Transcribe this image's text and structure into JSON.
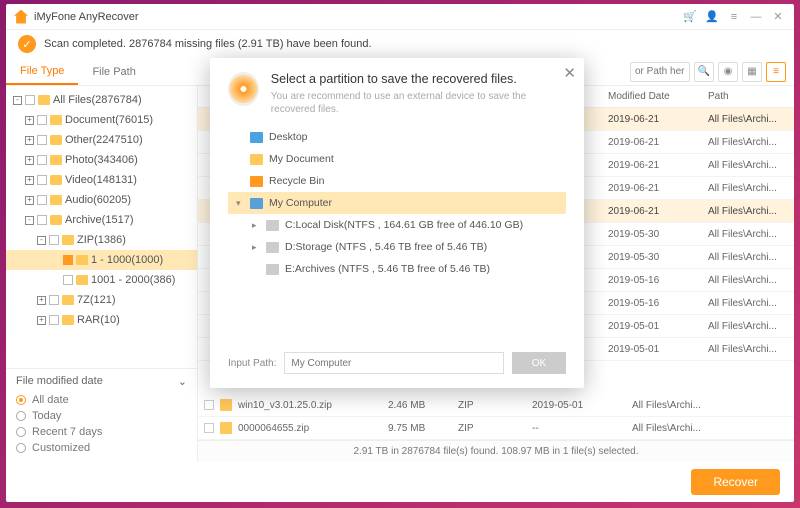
{
  "app_title": "iMyFone AnyRecover",
  "status": "Scan completed. 2876784 missing files (2.91 TB) have been found.",
  "tabs": {
    "file_type": "File Type",
    "file_path": "File Path"
  },
  "search_placeholder": "or Path here",
  "tree": [
    {
      "indent": 0,
      "label": "All Files(2876784)",
      "tog": "-"
    },
    {
      "indent": 1,
      "label": "Document(76015)",
      "tog": "+"
    },
    {
      "indent": 1,
      "label": "Other(2247510)",
      "tog": "+"
    },
    {
      "indent": 1,
      "label": "Photo(343406)",
      "tog": "+"
    },
    {
      "indent": 1,
      "label": "Video(148131)",
      "tog": "+"
    },
    {
      "indent": 1,
      "label": "Audio(60205)",
      "tog": "+"
    },
    {
      "indent": 1,
      "label": "Archive(1517)",
      "tog": "-"
    },
    {
      "indent": 2,
      "label": "ZIP(1386)",
      "tog": "-"
    },
    {
      "indent": 3,
      "label": "1 - 1000(1000)",
      "tog": "",
      "sel": true
    },
    {
      "indent": 3,
      "label": "1001 - 2000(386)",
      "tog": ""
    },
    {
      "indent": 2,
      "label": "7Z(121)",
      "tog": "+"
    },
    {
      "indent": 2,
      "label": "RAR(10)",
      "tog": "+"
    }
  ],
  "modified_section": {
    "title": "File modified date",
    "options": [
      "All date",
      "Today",
      "Recent 7 days",
      "Customized"
    ]
  },
  "columns": {
    "mod": "Modified Date",
    "path": "Path"
  },
  "rows": [
    {
      "mod": "2019-06-21",
      "path": "All Files\\Archi...",
      "sel": true
    },
    {
      "mod": "2019-06-21",
      "path": "All Files\\Archi..."
    },
    {
      "mod": "2019-06-21",
      "path": "All Files\\Archi..."
    },
    {
      "mod": "2019-06-21",
      "path": "All Files\\Archi..."
    },
    {
      "mod": "2019-06-21",
      "path": "All Files\\Archi...",
      "sel": true
    },
    {
      "mod": "2019-05-30",
      "path": "All Files\\Archi..."
    },
    {
      "mod": "2019-05-30",
      "path": "All Files\\Archi..."
    },
    {
      "mod": "2019-05-16",
      "path": "All Files\\Archi..."
    },
    {
      "mod": "2019-05-16",
      "path": "All Files\\Archi..."
    },
    {
      "mod": "2019-05-01",
      "path": "All Files\\Archi..."
    },
    {
      "mod": "2019-05-01",
      "path": "All Files\\Archi..."
    }
  ],
  "full_rows": [
    {
      "name": "win10_v3.01.25.0.zip",
      "size": "2.46 MB",
      "type": "ZIP",
      "mod": "2019-05-01",
      "path": "All Files\\Archi..."
    },
    {
      "name": "0000064655.zip",
      "size": "9.75 MB",
      "type": "ZIP",
      "mod": "--",
      "path": "All Files\\Archi..."
    }
  ],
  "summary": "2.91 TB in 2876784 file(s) found. 108.97 MB in 1 file(s) selected.",
  "recover_label": "Recover",
  "dialog": {
    "title": "Select a partition to save the recovered files.",
    "subtitle": "You are recommend to use an external device to save the recovered files.",
    "locations": [
      {
        "label": "Desktop",
        "ic": "desk",
        "indent": 0,
        "arrow": ""
      },
      {
        "label": "My Document",
        "ic": "doc",
        "indent": 0,
        "arrow": ""
      },
      {
        "label": "Recycle Bin",
        "ic": "rec",
        "indent": 0,
        "arrow": ""
      },
      {
        "label": "My Computer",
        "ic": "comp",
        "indent": 0,
        "arrow": "▾",
        "hl": true
      },
      {
        "label": "C:Local Disk(NTFS , 164.61 GB free of 446.10 GB)",
        "ic": "drive",
        "indent": 1,
        "arrow": "▸"
      },
      {
        "label": "D:Storage (NTFS , 5.46 TB free of 5.46 TB)",
        "ic": "drive",
        "indent": 1,
        "arrow": "▸"
      },
      {
        "label": "E:Archives (NTFS , 5.46 TB free of 5.46 TB)",
        "ic": "drive",
        "indent": 1,
        "arrow": ""
      }
    ],
    "input_label": "Input Path:",
    "input_placeholder": "My Computer",
    "ok_label": "OK"
  }
}
